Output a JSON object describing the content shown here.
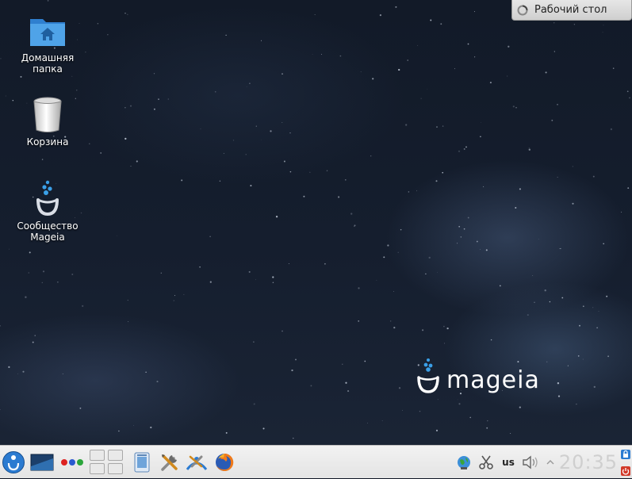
{
  "desktop": {
    "icons": [
      {
        "label_lines": [
          "Домашняя",
          "папка"
        ],
        "icon": "home-folder-icon"
      },
      {
        "label_lines": [
          "Корзина"
        ],
        "icon": "trash-icon"
      },
      {
        "label_lines": [
          "Сообщество",
          "Mageia"
        ],
        "icon": "mageia-community-icon"
      }
    ],
    "activity_label": "Рабочий стол",
    "brand_text": "mageia"
  },
  "taskbar": {
    "launchers": [
      "app-menu-icon",
      "show-desktop-icon",
      "color-dots-icon"
    ],
    "pager": {
      "rows": 2,
      "cols": 2
    },
    "quick_launch": [
      "file-manager-icon",
      "system-settings-icon",
      "control-center-icon",
      "firefox-icon"
    ],
    "tray": {
      "network_icon": "network-globe-icon",
      "clipboard_icon": "scissors-icon",
      "keyboard_layout": "us",
      "volume_icon": "speaker-icon",
      "expand_icon": "chevron-up-icon",
      "clock": "20:35"
    }
  },
  "colors": {
    "accent": "#2b7bd1",
    "taskbar": "#ebebeb"
  }
}
